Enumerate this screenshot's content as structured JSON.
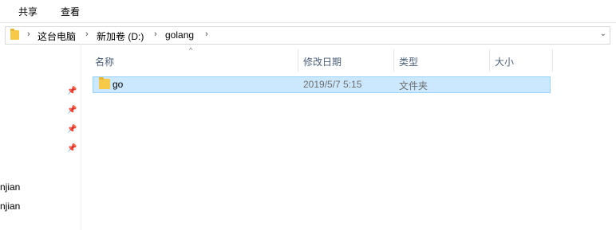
{
  "ribbon": {
    "tabs": [
      "共享",
      "查看"
    ]
  },
  "address_bar": {
    "crumbs": [
      "这台电脑",
      "新加卷 (D:)",
      "golang"
    ],
    "separator": "›",
    "dropdown_icon": "chevron-down-icon"
  },
  "navigation": {
    "pins": [
      "pin-icon",
      "pin-icon",
      "pin-icon",
      "pin-icon"
    ],
    "items": [
      "njian",
      "njian"
    ]
  },
  "file_list": {
    "columns": [
      "名称",
      "修改日期",
      "类型",
      "大小"
    ],
    "sort_indicator": "^",
    "rows": [
      {
        "name": "go",
        "modified": "2019/5/7 5:15",
        "type": "文件夹",
        "size": ""
      }
    ]
  },
  "colors": {
    "selection_bg": "#cce8ff",
    "selection_border": "#99d1ff",
    "header_text": "#4c607a",
    "folder": "#f7c948"
  }
}
